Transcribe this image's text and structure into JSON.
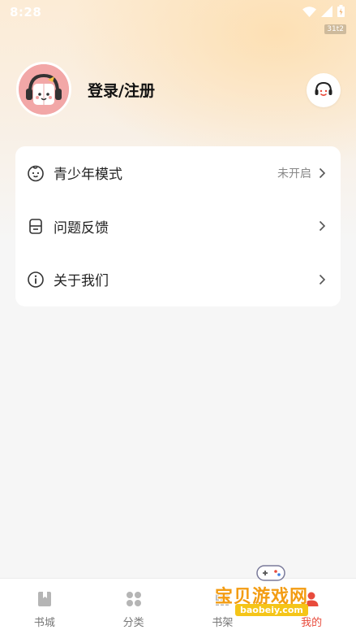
{
  "statusbar": {
    "time": "8:28",
    "network_badge": "31t2",
    "icons": [
      "wifi-icon",
      "cellular-signal-icon",
      "battery-charging-icon"
    ]
  },
  "profile": {
    "login_label": "登录/注册",
    "avatar_icon": "headphone-book-mascot",
    "service_icon": "customer-service-headset-icon"
  },
  "menu": {
    "items": [
      {
        "icon": "child-face-icon",
        "label": "青少年模式",
        "value": "未开启"
      },
      {
        "icon": "feedback-box-icon",
        "label": "问题反馈",
        "value": ""
      },
      {
        "icon": "info-circle-icon",
        "label": "关于我们",
        "value": ""
      }
    ]
  },
  "tabbar": {
    "tabs": [
      {
        "icon": "bookstore-icon",
        "label": "书城",
        "active": false
      },
      {
        "icon": "category-grid-icon",
        "label": "分类",
        "active": false
      },
      {
        "icon": "bookshelf-icon",
        "label": "书架",
        "active": false
      },
      {
        "icon": "profile-icon",
        "label": "我的",
        "active": true
      }
    ],
    "active_color": "#e84b3c",
    "inactive_color": "#777777"
  },
  "watermark": {
    "title": "宝贝游戏网",
    "url": "baobeiy.com"
  },
  "colors": {
    "accent": "#e84b3c",
    "header_gradient": "#fde0b4",
    "background": "#f6f6f6"
  }
}
